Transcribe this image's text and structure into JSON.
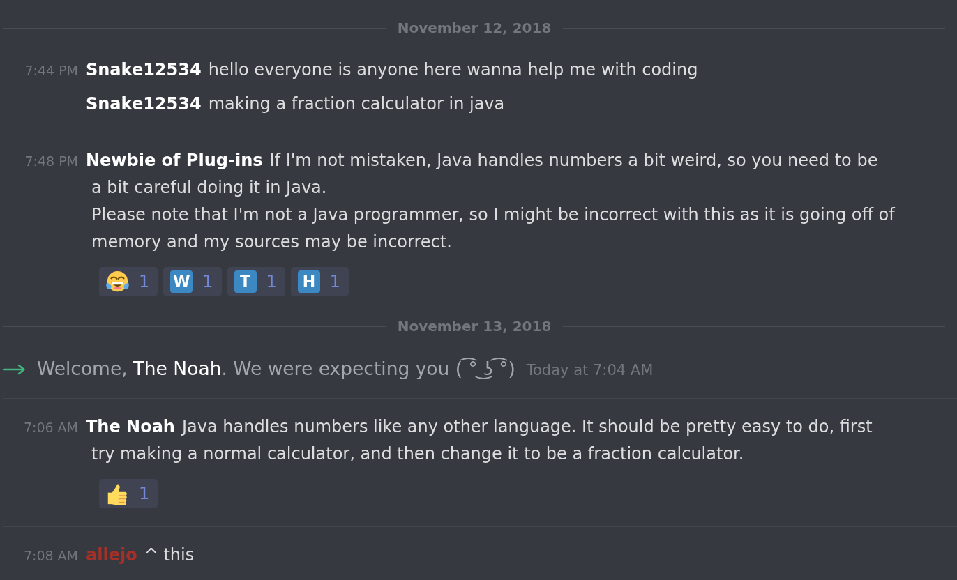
{
  "feed": [
    {
      "kind": "date",
      "label": "November 12, 2018"
    },
    {
      "kind": "group",
      "messages": [
        {
          "timestamp": "7:44 PM",
          "author": "Snake12534",
          "color": "#ffffff",
          "lines": [
            "hello everyone is anyone here wanna help me with coding"
          ]
        },
        {
          "author": "Snake12534",
          "color": "#ffffff",
          "lines": [
            "making a fraction calculator in java"
          ]
        }
      ]
    },
    {
      "kind": "group",
      "messages": [
        {
          "timestamp": "7:48 PM",
          "author": "Newbie of Plug-ins",
          "color": "#ffffff",
          "lines": [
            "If I'm not mistaken, Java handles numbers a bit weird, so you need to be",
            "a bit careful doing it in Java.",
            "Please note that I'm not a Java programmer, so I might be incorrect with this as it is going off of",
            "memory and my sources may be incorrect."
          ],
          "reactions": [
            {
              "kind": "laughing",
              "count": "1"
            },
            {
              "kind": "letter",
              "letter": "W",
              "count": "1"
            },
            {
              "kind": "letter",
              "letter": "T",
              "count": "1"
            },
            {
              "kind": "letter",
              "letter": "H",
              "count": "1"
            }
          ]
        }
      ]
    },
    {
      "kind": "date",
      "label": "November 13, 2018"
    },
    {
      "kind": "join",
      "before": "Welcome,",
      "user": "The Noah",
      "after": ". We were expecting you ( ͡° ͜ʖ ͡°)",
      "timestamp": "Today at 7:04 AM"
    },
    {
      "kind": "group",
      "messages": [
        {
          "timestamp": "7:06 AM",
          "author": "The Noah",
          "color": "#ffffff",
          "lines": [
            "Java handles numbers like any other language. It should be pretty easy to do, first",
            "try making a normal calculator, and then change it to be a fraction calculator."
          ],
          "reactions": [
            {
              "kind": "thumbsup",
              "count": "1"
            }
          ]
        }
      ]
    },
    {
      "kind": "group",
      "messages": [
        {
          "timestamp": "7:08 AM",
          "author": "allejo",
          "color": "#a62f28",
          "lines": [
            "^ this"
          ]
        }
      ]
    }
  ]
}
